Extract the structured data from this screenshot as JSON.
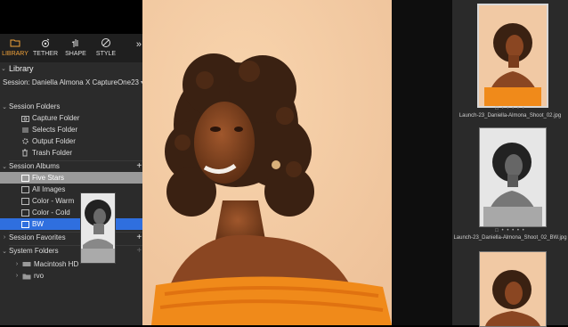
{
  "tabs": [
    {
      "label": "LIBRARY",
      "icon": "folder-icon",
      "active": true
    },
    {
      "label": "TETHER",
      "icon": "camera-icon",
      "active": false
    },
    {
      "label": "SHAPE",
      "icon": "hand-icon",
      "active": false
    },
    {
      "label": "STYLE",
      "icon": "palette-icon",
      "active": false
    }
  ],
  "library": {
    "title": "Library",
    "session_label": "Session: Daniella Almona X CaptureOne23"
  },
  "session_folders": {
    "title": "Session Folders",
    "items": [
      "Capture Folder",
      "Selects Folder",
      "Output Folder",
      "Trash Folder"
    ]
  },
  "session_albums": {
    "title": "Session Albums",
    "items": [
      "Five Stars",
      "All Images",
      "Color - Warm",
      "Color - Cold",
      "BW"
    ]
  },
  "session_favorites": {
    "title": "Session Favorites"
  },
  "system_folders": {
    "title": "System Folders",
    "items": [
      "Macintosh HD",
      "rvo"
    ]
  },
  "thumbnails": [
    {
      "label": "Launch-23_Daniella-Almona_Shoot_02.jpg"
    },
    {
      "label": "Launch-23_Daniella-Almona_Shoot_02_BW.jpg"
    },
    {
      "label": ""
    }
  ],
  "colors": {
    "accent": "#f2a33a",
    "selection": "#2f6fdf",
    "panel": "#2b2b2b"
  }
}
